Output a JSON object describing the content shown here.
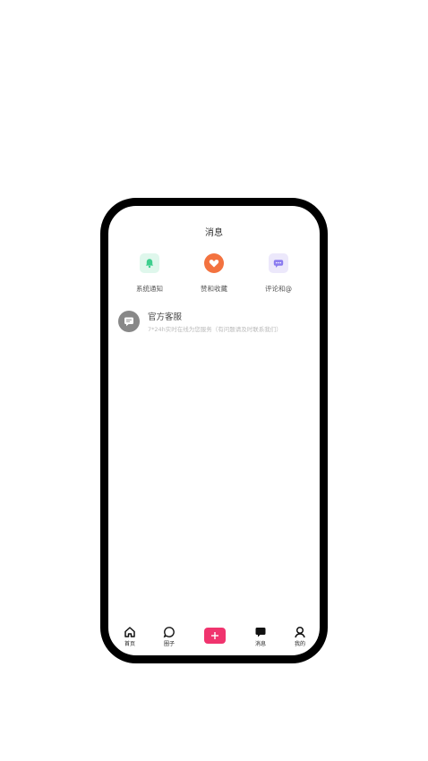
{
  "header": {
    "title": "消息"
  },
  "quick_actions": [
    {
      "label": "系统通知",
      "icon": "bell-icon"
    },
    {
      "label": "赞和收藏",
      "icon": "heart-icon"
    },
    {
      "label": "评论和@",
      "icon": "chat-bubble-icon"
    }
  ],
  "messages": [
    {
      "name": "官方客服",
      "preview": "7*24h实时在线为您服务（有问题请及时联系我们）",
      "icon": "message-icon"
    }
  ],
  "tabbar": {
    "items": [
      {
        "label": "首页",
        "icon": "home-icon"
      },
      {
        "label": "圈子",
        "icon": "circle-chat-icon"
      },
      {
        "label": "",
        "icon": "plus-icon"
      },
      {
        "label": "消息",
        "icon": "message-icon"
      },
      {
        "label": "我的",
        "icon": "user-icon"
      }
    ],
    "accent": "#f0346e"
  },
  "colors": {
    "system_notice_icon": "#3ecf8e",
    "likes_icon": "#f3723f",
    "comments_icon": "#8b7cf0"
  }
}
